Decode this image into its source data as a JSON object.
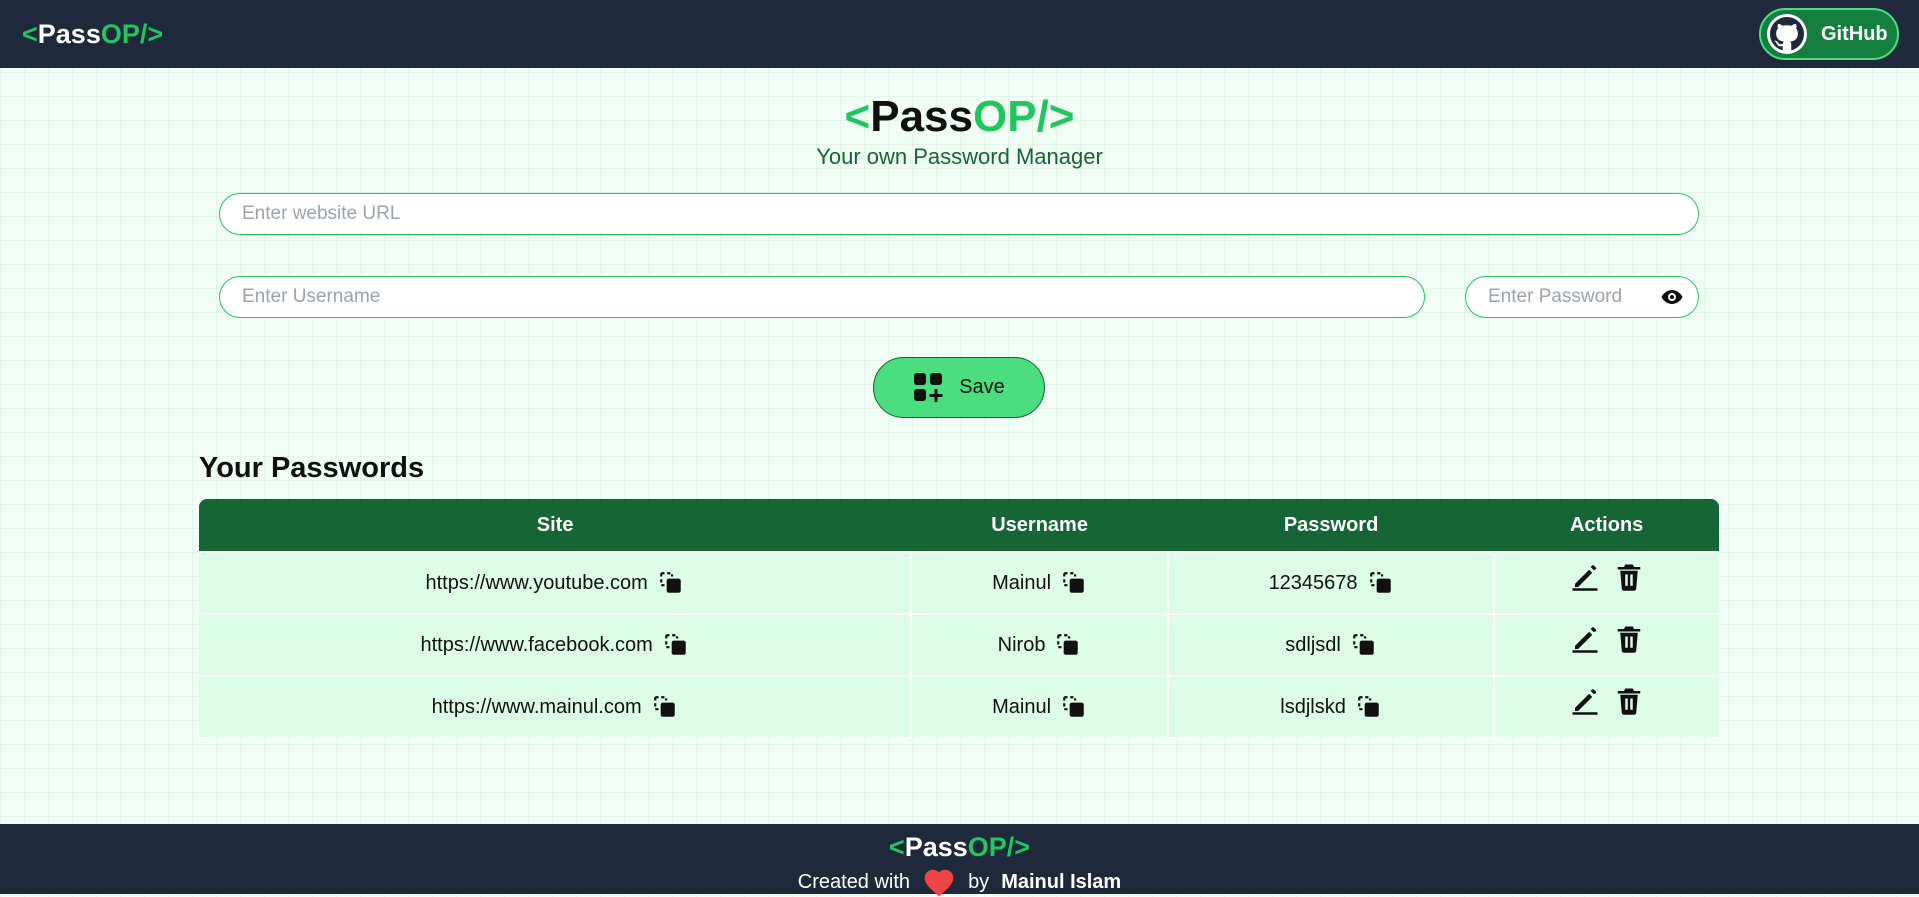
{
  "brand": {
    "open": "<",
    "pass": "Pass",
    "op": "OP",
    "close": "/>"
  },
  "navbar": {
    "github_label": "GitHub"
  },
  "hero": {
    "subtitle": "Your own Password Manager"
  },
  "form": {
    "url_placeholder": "Enter website URL",
    "username_placeholder": "Enter Username",
    "password_placeholder": "Enter Password",
    "save_label": "Save"
  },
  "passwords": {
    "title": "Your Passwords",
    "columns": [
      "Site",
      "Username",
      "Password",
      "Actions"
    ],
    "rows": [
      {
        "site": "https://www.youtube.com",
        "username": "Mainul",
        "password": "12345678"
      },
      {
        "site": "https://www.facebook.com",
        "username": "Nirob",
        "password": "sdljsdl"
      },
      {
        "site": "https://www.mainul.com",
        "username": "Mainul",
        "password": "lsdjlskd"
      }
    ]
  },
  "footer": {
    "created_with": "Created with",
    "by": "by",
    "author": "Mainul Islam"
  },
  "colors": {
    "accent": "#22c55e",
    "dark": "#1e293b",
    "table_header": "#166534",
    "row_bg": "#dcfce7",
    "heart": "#ef4444"
  },
  "icons": [
    "github-icon",
    "eye-icon",
    "add-grid-icon",
    "copy-icon",
    "edit-icon",
    "trash-icon",
    "heart-icon"
  ]
}
